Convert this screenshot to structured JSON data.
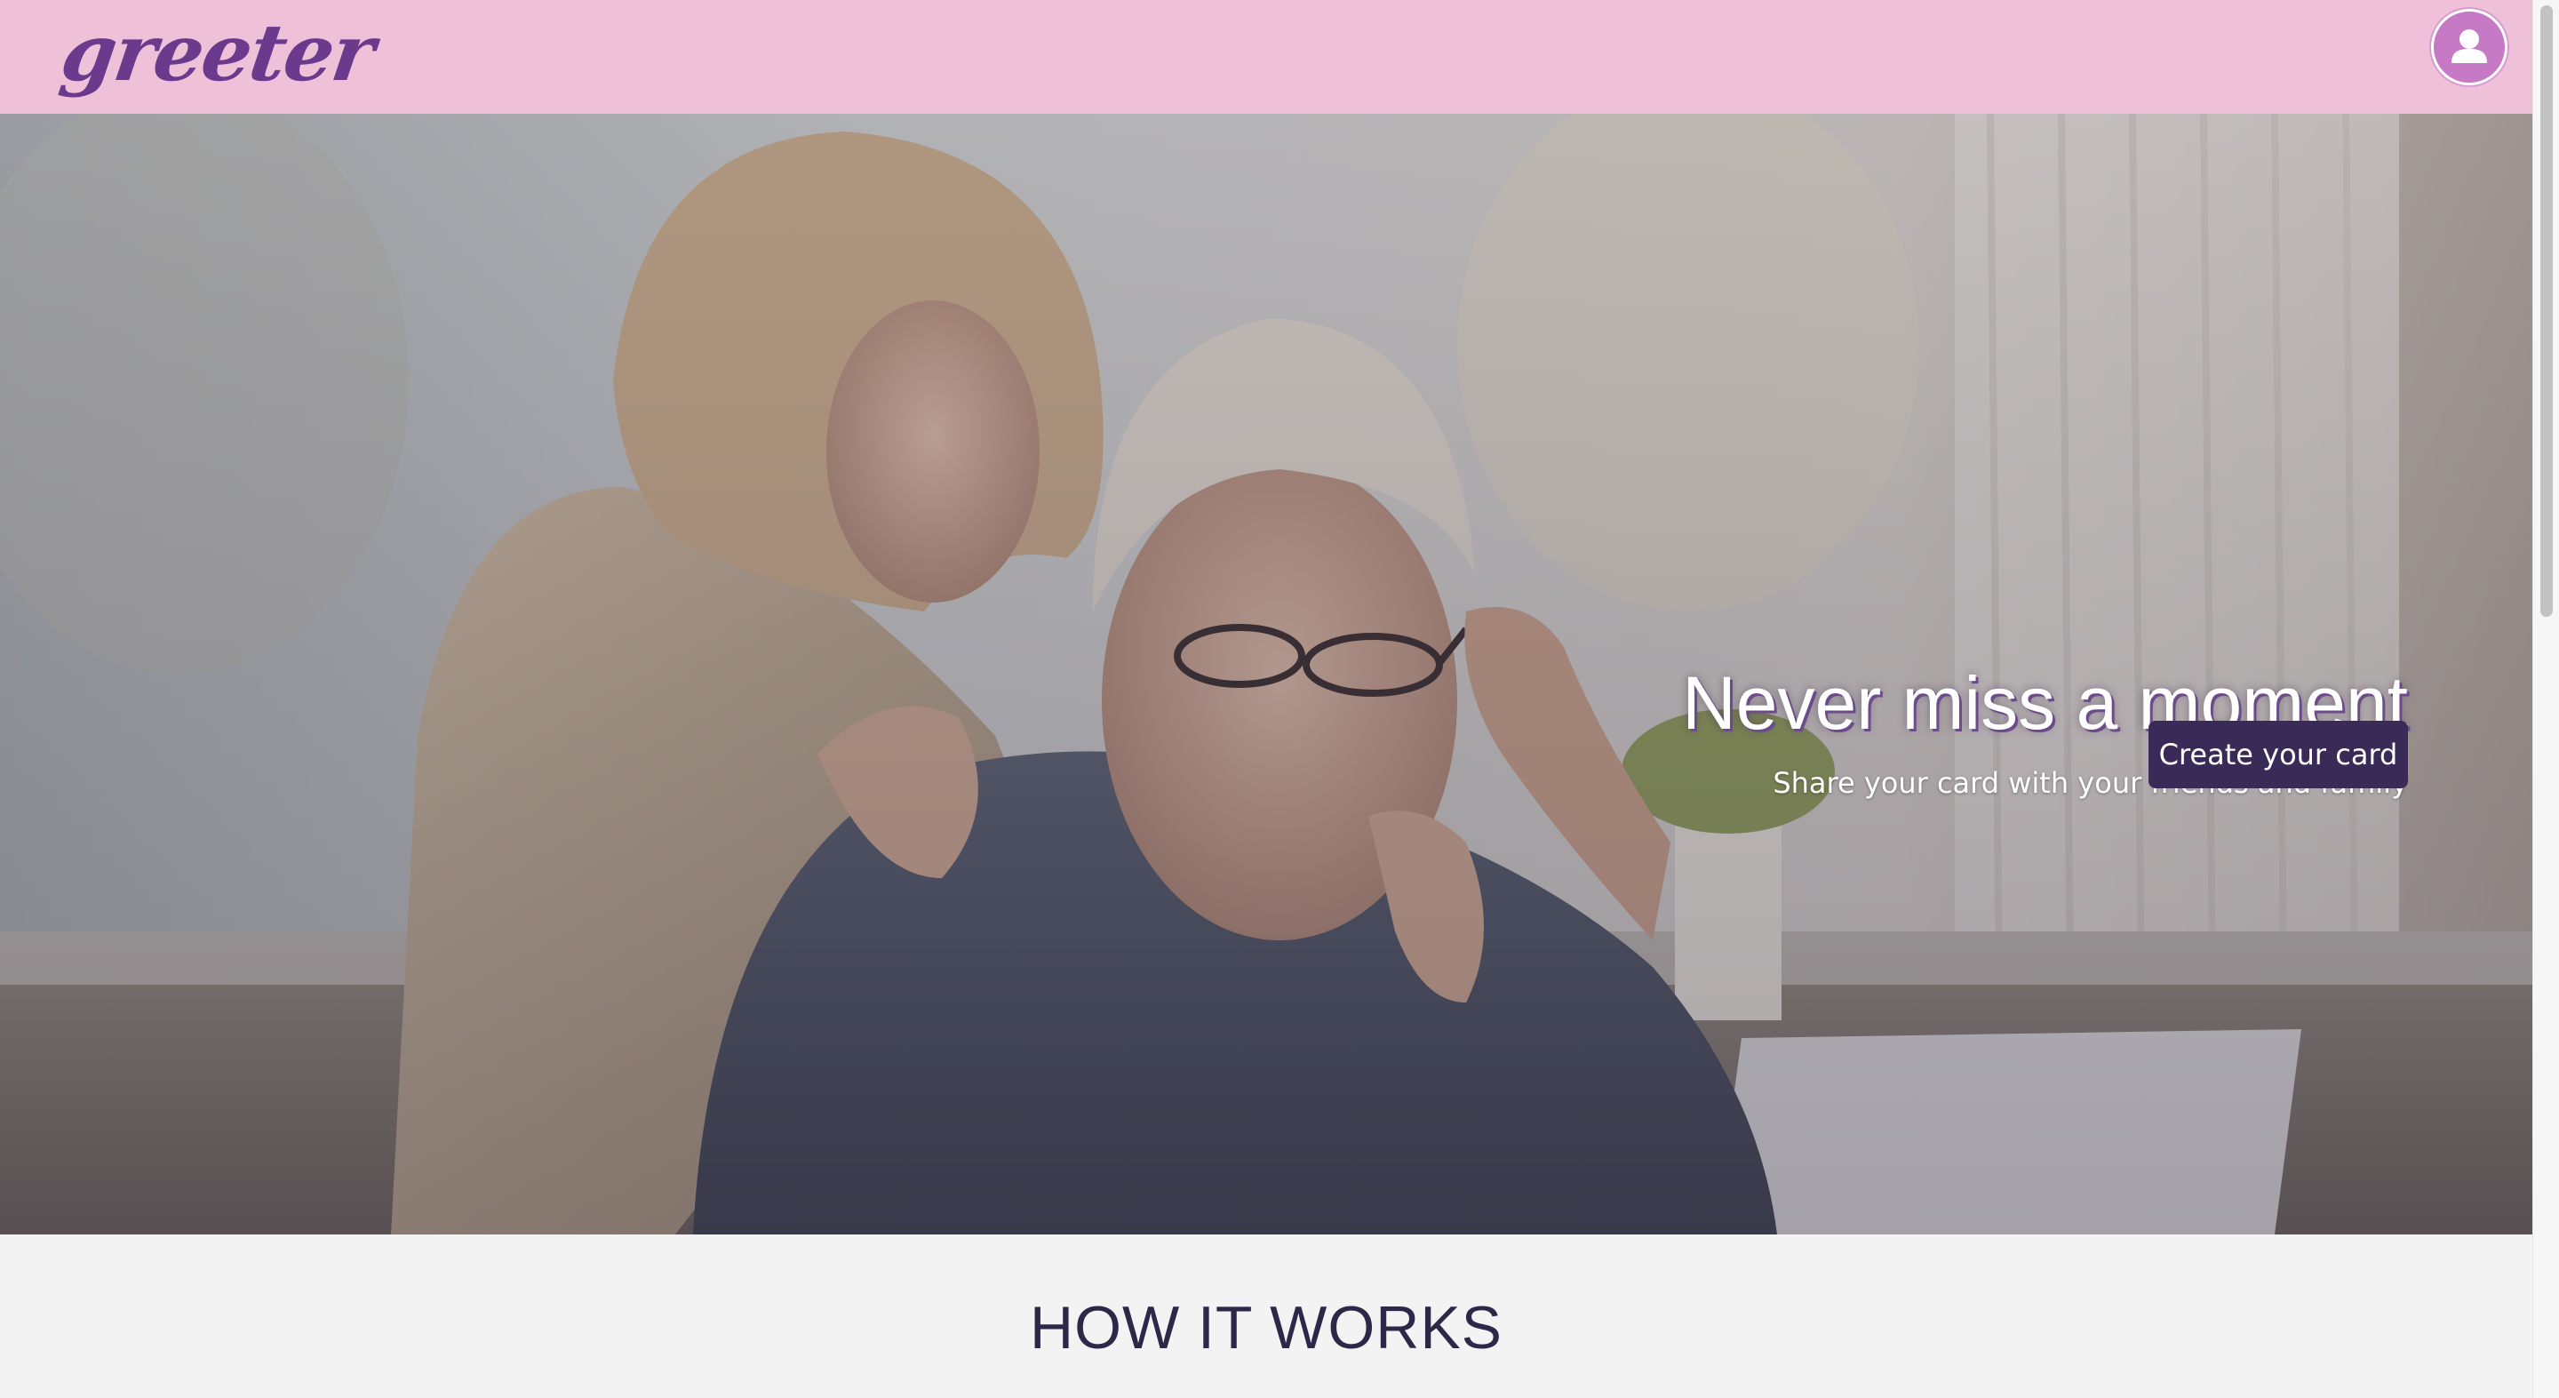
{
  "app": {
    "logo_text": "greeter"
  },
  "header": {
    "avatar_icon": "user-icon"
  },
  "hero": {
    "title": "Never miss a moment",
    "subtitle": "Share your card with your friends and family",
    "cta_label": "Create your card"
  },
  "section": {
    "how_it_works_title": "HOW IT WORKS"
  },
  "colors": {
    "navbar": "#efc1d8",
    "logo": "#6b3a8c",
    "cta_background": "#3a2a57",
    "heading": "#2d2748",
    "page_background": "#f3f3f3"
  }
}
